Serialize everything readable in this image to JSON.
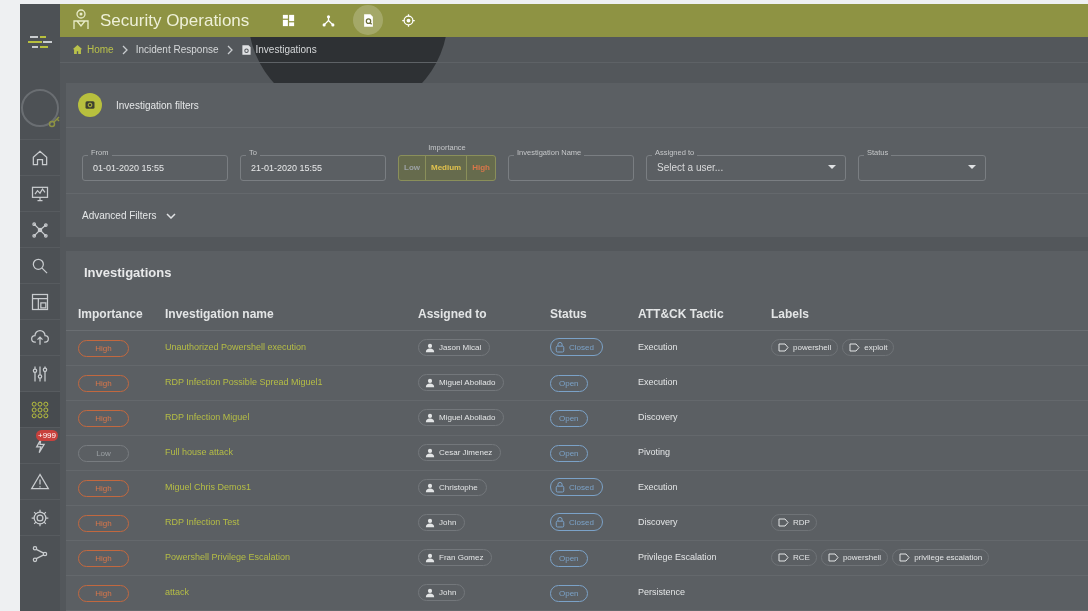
{
  "app": {
    "title": "Security Operations"
  },
  "nav_icons": [
    {
      "kind": "grid",
      "selected": false
    },
    {
      "kind": "nodes",
      "selected": false
    },
    {
      "kind": "doc",
      "selected": true
    },
    {
      "kind": "target",
      "selected": false
    }
  ],
  "breadcrumb": [
    {
      "kind": "home",
      "label": "Home"
    },
    {
      "kind": "plain",
      "label": "Incident Response"
    },
    {
      "kind": "doc",
      "label": "Investigations"
    }
  ],
  "sidebar": {
    "items": [
      {
        "kind": "home",
        "selected": false
      },
      {
        "kind": "monitor",
        "selected": false
      },
      {
        "kind": "nodes",
        "selected": false
      },
      {
        "kind": "search",
        "selected": false
      },
      {
        "kind": "layout",
        "selected": false
      },
      {
        "kind": "cloud",
        "selected": false
      },
      {
        "kind": "sliders",
        "selected": false
      },
      {
        "kind": "grid",
        "selected": true
      },
      {
        "kind": "bolt",
        "selected": false,
        "badge": "+999"
      },
      {
        "kind": "warning",
        "selected": false
      },
      {
        "kind": "gear",
        "selected": false
      },
      {
        "kind": "share",
        "selected": false
      }
    ]
  },
  "filters": {
    "title": "Investigation filters",
    "from": {
      "label": "From",
      "value": "01-01-2020 15:55"
    },
    "to": {
      "label": "To",
      "value": "21-01-2020 15:55"
    },
    "importance": {
      "label": "Importance",
      "options": [
        {
          "label": "Low",
          "kind": "low"
        },
        {
          "label": "Medium",
          "kind": "medium"
        },
        {
          "label": "High",
          "kind": "high"
        }
      ]
    },
    "name": {
      "label": "Investigation Name"
    },
    "assigned": {
      "label": "Assigned to",
      "placeholder": "Select a user..."
    },
    "status": {
      "label": "Status"
    },
    "advanced": "Advanced Filters"
  },
  "table": {
    "title": "Investigations",
    "columns": [
      "Importance",
      "Investigation name",
      "Assigned to",
      "Status",
      "ATT&CK Tactic",
      "Labels"
    ],
    "rows": [
      {
        "importance": {
          "label": "High",
          "kind": "high"
        },
        "name": "Unauthorized Powershell execution",
        "assigned": "Jason Mical",
        "status": {
          "label": "Closed",
          "kind": "closed"
        },
        "tactic": "Execution",
        "labels": [
          "powershell",
          "exploit"
        ]
      },
      {
        "importance": {
          "label": "High",
          "kind": "high"
        },
        "name": "RDP Infection Possible Spread Miguel1",
        "assigned": "Miguel Abollado",
        "status": {
          "label": "Open",
          "kind": "open"
        },
        "tactic": "Execution",
        "labels": []
      },
      {
        "importance": {
          "label": "High",
          "kind": "high"
        },
        "name": "RDP Infection Miguel",
        "assigned": "Miguel Abollado",
        "status": {
          "label": "Open",
          "kind": "open"
        },
        "tactic": "Discovery",
        "labels": []
      },
      {
        "importance": {
          "label": "Low",
          "kind": "low"
        },
        "name": "Full house attack",
        "assigned": "Cesar Jimenez",
        "status": {
          "label": "Open",
          "kind": "open"
        },
        "tactic": "Pivoting",
        "labels": []
      },
      {
        "importance": {
          "label": "High",
          "kind": "high"
        },
        "name": "Miguel Chris Demos1",
        "assigned": "Christophe",
        "status": {
          "label": "Closed",
          "kind": "closed"
        },
        "tactic": "Execution",
        "labels": []
      },
      {
        "importance": {
          "label": "High",
          "kind": "high"
        },
        "name": "RDP Infection Test",
        "assigned": "John",
        "status": {
          "label": "Closed",
          "kind": "closed"
        },
        "tactic": "Discovery",
        "labels": [
          "RDP"
        ]
      },
      {
        "importance": {
          "label": "High",
          "kind": "high"
        },
        "name": "Powershell Privilege Escalation",
        "assigned": "Fran Gomez",
        "status": {
          "label": "Open",
          "kind": "open"
        },
        "tactic": "Privilege Escalation",
        "labels": [
          "RCE",
          "powershell",
          "privilege escalation"
        ]
      },
      {
        "importance": {
          "label": "High",
          "kind": "high"
        },
        "name": "attack",
        "assigned": "John",
        "status": {
          "label": "Open",
          "kind": "open"
        },
        "tactic": "Persistence",
        "labels": []
      }
    ]
  }
}
